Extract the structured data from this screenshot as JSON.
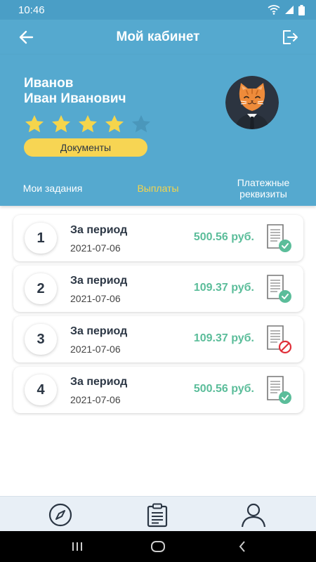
{
  "status_bar": {
    "time": "10:46"
  },
  "header": {
    "title": "Мой кабинет"
  },
  "profile": {
    "last_name": "Иванов",
    "first_middle": "Иван Иванович",
    "rating": 4,
    "max_rating": 5,
    "documents_button": "Документы"
  },
  "tabs": [
    {
      "label": "Мои задания",
      "active": false
    },
    {
      "label": "Выплаты",
      "active": true
    },
    {
      "label_line1": "Платежные",
      "label_line2": "реквизиты",
      "active": false
    }
  ],
  "payments": [
    {
      "number": "1",
      "title": "За период",
      "date": "2021-07-06",
      "amount": "500.56 руб.",
      "status": "approved"
    },
    {
      "number": "2",
      "title": "За период",
      "date": "2021-07-06",
      "amount": "109.37 руб.",
      "status": "approved"
    },
    {
      "number": "3",
      "title": "За период",
      "date": "2021-07-06",
      "amount": "109.37 руб.",
      "status": "rejected"
    },
    {
      "number": "4",
      "title": "За период",
      "date": "2021-07-06",
      "amount": "500.56 руб.",
      "status": "approved"
    }
  ],
  "colors": {
    "primary": "#55a9cf",
    "accent_yellow": "#f7d553",
    "amount_green": "#5bbd9a",
    "approved": "#5bbd9a",
    "rejected": "#e0303a",
    "star_filled": "#f5d54c",
    "star_empty": "#4a97bb"
  },
  "icons": {
    "back": "arrow-left-icon",
    "logout": "logout-icon",
    "nav_1": "compass-icon",
    "nav_2": "clipboard-list-icon",
    "nav_3": "user-icon"
  }
}
